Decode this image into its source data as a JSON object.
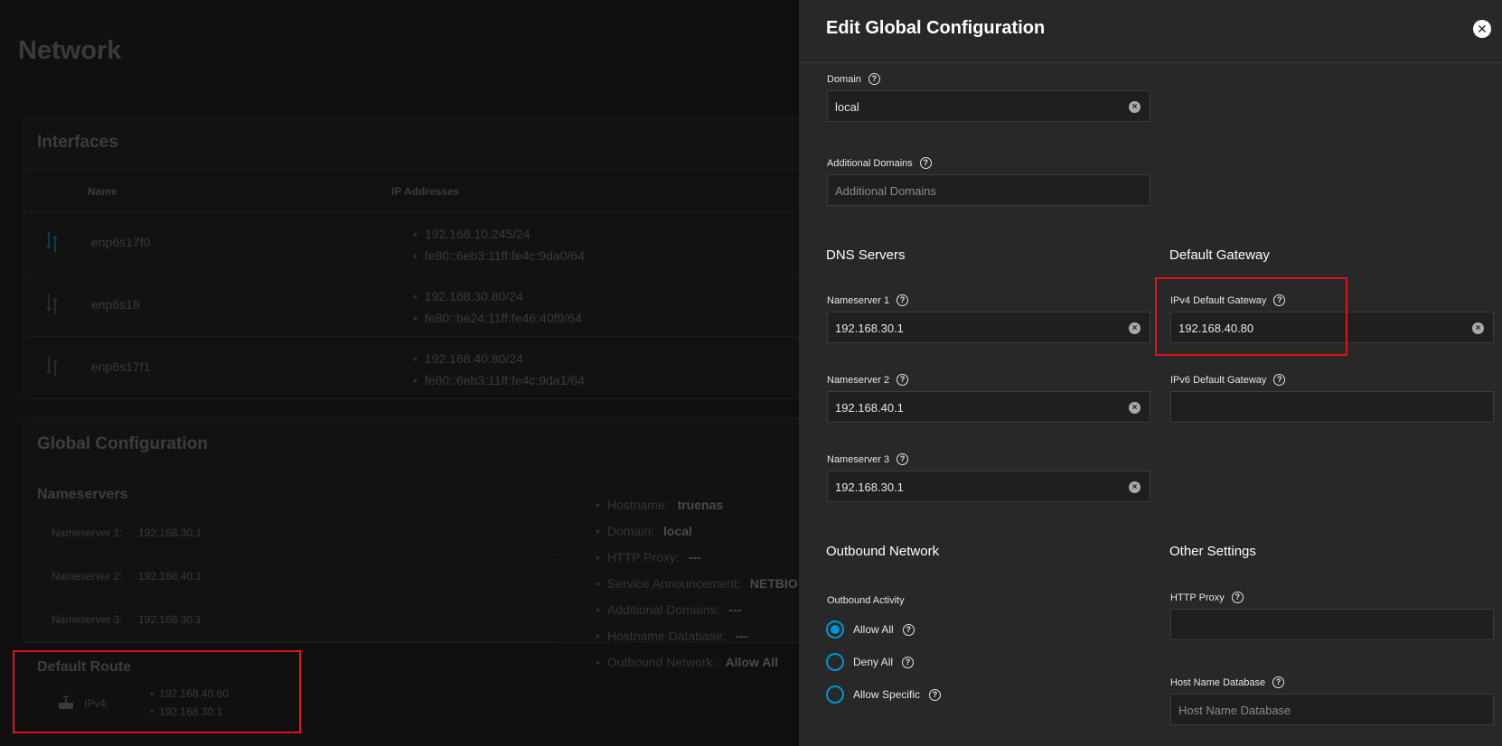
{
  "page": {
    "title": "Network"
  },
  "interfaces": {
    "title": "Interfaces",
    "columns": [
      "Name",
      "IP Addresses"
    ],
    "rows": [
      {
        "name": "enp6s17f0",
        "ips": [
          "192.168.10.245/24",
          "fe80::6eb3:11ff:fe4c:9da0/64"
        ]
      },
      {
        "name": "enp6s18",
        "ips": [
          "192.168.30.80/24",
          "fe80::be24:11ff:fe46:40f9/64"
        ]
      },
      {
        "name": "enp6s17f1",
        "ips": [
          "192.168.40.80/24",
          "fe80::6eb3:11ff:fe4c:9da1/64"
        ]
      }
    ]
  },
  "global_config": {
    "title": "Global Configuration",
    "nameservers_title": "Nameservers",
    "nameservers": [
      {
        "label": "Nameserver 1:",
        "value": "192.168.30.1"
      },
      {
        "label": "Nameserver 2:",
        "value": "192.168.40.1"
      },
      {
        "label": "Nameserver 3:",
        "value": "192.168.30.1"
      }
    ],
    "info": [
      {
        "label": "Hostname:",
        "value": "truenas"
      },
      {
        "label": "Domain:",
        "value": "local"
      },
      {
        "label": "HTTP Proxy:",
        "value": "---"
      },
      {
        "label": "Service Announcement:",
        "value": "NETBIO"
      },
      {
        "label": "Additional Domains:",
        "value": "---"
      },
      {
        "label": "Hostname Database:",
        "value": "---"
      },
      {
        "label": "Outbound Network:",
        "value": "Allow All"
      }
    ]
  },
  "default_route": {
    "title": "Default Route",
    "label": "IPv4:",
    "values": [
      "192.168.40.80",
      "192.168.30.1"
    ]
  },
  "drawer": {
    "title": "Edit Global Configuration",
    "domain": {
      "label": "Domain",
      "value": "local"
    },
    "additional_domains": {
      "label": "Additional Domains",
      "placeholder": "Additional Domains"
    },
    "dns_title": "DNS Servers",
    "gateway_title": "Default Gateway",
    "nameserver1": {
      "label": "Nameserver 1",
      "value": "192.168.30.1"
    },
    "nameserver2": {
      "label": "Nameserver 2",
      "value": "192.168.40.1"
    },
    "nameserver3": {
      "label": "Nameserver 3",
      "value": "192.168.30.1"
    },
    "ipv4_gateway": {
      "label": "IPv4 Default Gateway",
      "value": "192.168.40.80"
    },
    "ipv6_gateway": {
      "label": "IPv6 Default Gateway",
      "value": ""
    },
    "outbound_title": "Outbound Network",
    "outbound_activity_label": "Outbound Activity",
    "outbound_options": [
      "Allow All",
      "Deny All",
      "Allow Specific"
    ],
    "outbound_selected": "Allow All",
    "other_title": "Other Settings",
    "http_proxy": {
      "label": "HTTP Proxy",
      "value": ""
    },
    "host_name_database": {
      "label": "Host Name Database",
      "placeholder": "Host Name Database"
    }
  },
  "colors": {
    "accent": "#0095d5",
    "highlight_box": "#e0131a",
    "drawer_bg": "#282828"
  }
}
